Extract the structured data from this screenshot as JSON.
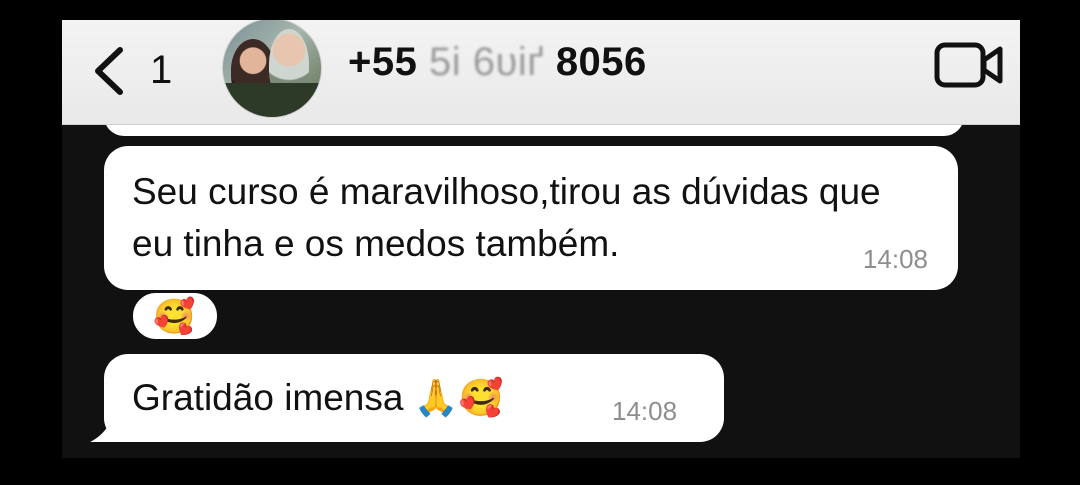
{
  "header": {
    "back_count": "1",
    "contact_prefix": "+55",
    "contact_obscured": "5і 6υіґ",
    "contact_suffix": "8056"
  },
  "messages": [
    {
      "text": "Seu curso é maravilhoso,tirou as dúvidas que eu tinha e os medos também.",
      "time": "14:08",
      "reaction": "🥰"
    },
    {
      "text": "Gratidão imensa",
      "emojis": "🙏🥰",
      "time": "14:08"
    }
  ],
  "colors": {
    "header_bg": "#eeeeee",
    "chat_bg": "#111111",
    "bubble": "#ffffff",
    "time": "#8e8e8e"
  },
  "icons": [
    "chevron-left-icon",
    "video-call-icon"
  ]
}
